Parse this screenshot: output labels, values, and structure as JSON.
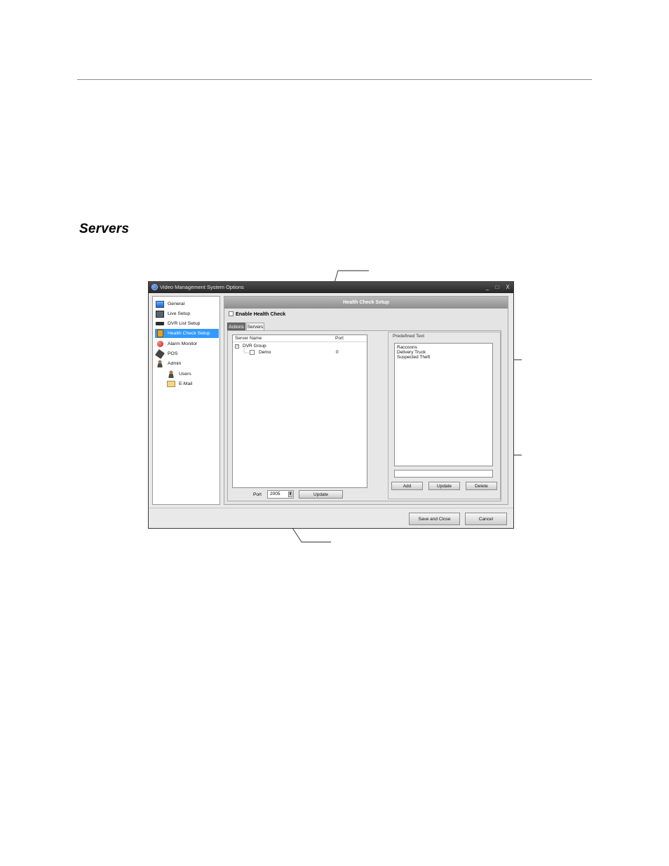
{
  "document": {
    "section_heading": "Servers"
  },
  "window": {
    "title": "Video Management System Options",
    "controls": {
      "minimize": "_",
      "maximize": "□",
      "close": "X"
    }
  },
  "nav": {
    "items": [
      {
        "label": "General",
        "icon": "monitor-icon"
      },
      {
        "label": "Live Setup",
        "icon": "live-camera-icon"
      },
      {
        "label": "DVR List Setup",
        "icon": "dvr-icon"
      },
      {
        "label": "Health Check Setup",
        "icon": "health-check-icon",
        "selected": true
      },
      {
        "label": "Alarm Monitor",
        "icon": "alarm-icon"
      },
      {
        "label": "POS",
        "icon": "pos-icon"
      },
      {
        "label": "Admin",
        "icon": "admin-icon"
      },
      {
        "label": "Users",
        "icon": "user-icon"
      },
      {
        "label": "E-Mail",
        "icon": "email-icon"
      }
    ]
  },
  "panel": {
    "header": "Health Check Setup",
    "enable_label": "Enable Health Check",
    "enable_checked": false,
    "tabs": {
      "actions": "Actions",
      "servers": "Servers"
    },
    "server_table": {
      "col_server": "Server Name",
      "col_port": "Port",
      "group": "DVR Group",
      "server": "Demo",
      "server_port": "0"
    },
    "port": {
      "label": "Port",
      "value": "2005"
    },
    "update_button": "Update",
    "predefined": {
      "legend": "Predefined Text",
      "items": [
        "Raccoons",
        "Delivery Truck",
        "Suspected Theft"
      ],
      "input_value": "",
      "buttons": {
        "add": "Add",
        "update": "Update",
        "delete": "Delete"
      }
    }
  },
  "footer": {
    "save_close": "Save and Close",
    "cancel": "Cancel"
  },
  "colors": {
    "selection": "#3399ff",
    "titlebar": "#2f2f2f",
    "panel_header": "#a3a3a3"
  }
}
